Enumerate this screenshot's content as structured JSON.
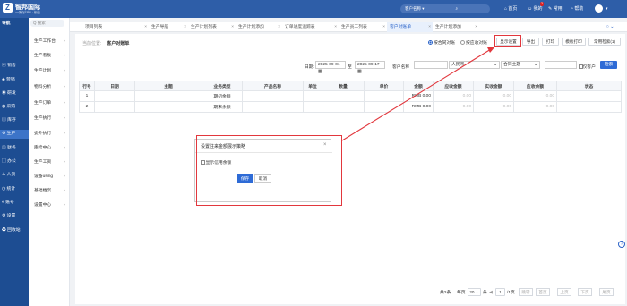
{
  "header": {
    "logo": "Z",
    "brand": "智邦国际",
    "brand_sub": "一体化ERP · 系统",
    "search_label": "客户名称",
    "items": [
      "首页",
      "我的",
      "常用",
      "帮助"
    ],
    "badge": "2"
  },
  "sidebar": {
    "nav_label": "导航",
    "quick_search": "Q 搜索",
    "items": [
      "销售",
      "营销",
      "研发",
      "采购",
      "库存",
      "生产",
      "财务",
      "办公",
      "人资",
      "统计",
      "账号",
      "设置",
      "回收站"
    ],
    "active_index": 5
  },
  "subnav": {
    "items": [
      "生产工作台",
      "生产看板",
      "生产计划",
      "物料分析",
      "生产订单",
      "生产执行",
      "委外执行",
      "质检中心",
      "生产工资",
      "设备using",
      "基础档案",
      "设置中心"
    ]
  },
  "tabs": {
    "items": [
      "项目列表",
      "生产导航",
      "生产计划列表",
      "生产计划添加",
      "订单进度追踪表",
      "生产员工列表",
      "客户对账单",
      "生产计划添加"
    ],
    "active_index": 6
  },
  "page": {
    "crumb_label": "当前位置:",
    "crumb_title": "客户对账单",
    "radio_contract": "按合同对账",
    "radio_receivable": "按应收对账",
    "buttons": [
      "显示设置",
      "导出",
      "打印",
      "模板打印",
      "常用检索(1)"
    ]
  },
  "filters": {
    "date_label": "日期:",
    "date_from": "2025-09-01",
    "date_to": "2025-09-17",
    "customer_label": "客户名称",
    "currency": "人民币",
    "contract": "合同主题",
    "only_customer": "仅客户",
    "query": "检索"
  },
  "table": {
    "headers": [
      "行号",
      "日期",
      "主题",
      "业务类型",
      "产品名称",
      "单位",
      "数量",
      "单价",
      "金额",
      "应收金额",
      "实收金额",
      "应收余额",
      "状态"
    ],
    "rows": [
      {
        "no": "1",
        "type": "期初余额",
        "amount": "RMB 0.00",
        "receivable": "0.00",
        "received": "0.00",
        "balance": "0.00"
      },
      {
        "no": "2",
        "type": "期末余额",
        "amount": "RMB 0.00",
        "receivable": "0.00",
        "received": "0.00",
        "balance": "0.00"
      }
    ]
  },
  "pager": {
    "total": "共2条",
    "per_page_label": "每页",
    "per_page": "20",
    "unit": "条",
    "page": "1",
    "pages": "/1页",
    "buttons": [
      "跳转",
      "首页",
      "上页",
      "下页",
      "尾页"
    ]
  },
  "modal": {
    "title": "设置往来金额展示策略",
    "close": "×",
    "checkbox_label": "显示信用余额",
    "save": "保存",
    "cancel": "取消"
  },
  "help": "?",
  "colors": {
    "header": "#2e5ea8",
    "sidebar": "#1d4d92",
    "accent": "#2e6bd6",
    "highlight": "#e2373d"
  }
}
